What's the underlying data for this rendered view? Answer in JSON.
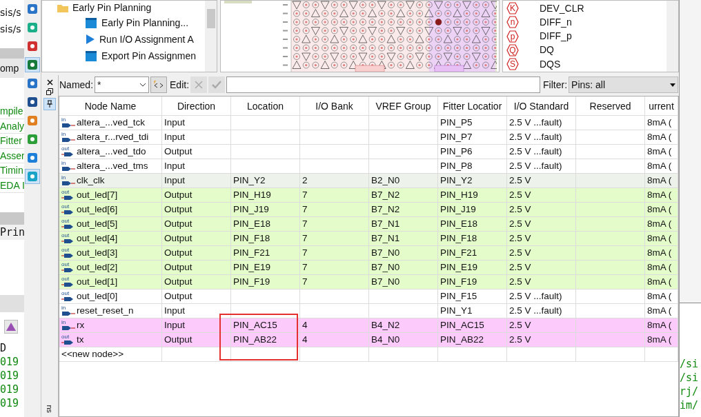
{
  "main_app": {
    "top_paths": [
      "sis/s",
      "sis/s"
    ],
    "panel_header": "omp",
    "flow_items": [
      "mpile",
      "Analy",
      "Fitter",
      "Asser",
      "Timin",
      "EDA I"
    ],
    "console_tab": "Prin",
    "message_header": "D",
    "message_lines": [
      "019",
      "019",
      "019",
      "019"
    ],
    "right_fragments": [
      "/si",
      "/si",
      "rj/",
      "im/"
    ]
  },
  "pin_planner": {
    "tasks": [
      {
        "label": "Early Pin Planning",
        "kind": "folder"
      },
      {
        "label": "Early Pin Planning...",
        "kind": "task"
      },
      {
        "label": "Run I/O Assignment A",
        "kind": "run"
      },
      {
        "label": "Export Pin Assignmen",
        "kind": "task"
      }
    ],
    "legend": [
      {
        "symbol": "K",
        "label": "DEV_CLR"
      },
      {
        "symbol": "n",
        "label": "DIFF_n"
      },
      {
        "symbol": "p",
        "label": "DIFF_p"
      },
      {
        "symbol": "Q",
        "label": "DQ"
      },
      {
        "symbol": "S",
        "label": "DQS"
      }
    ],
    "side_tab": "ns",
    "toolbar": {
      "named_label": "Named:",
      "named_value": "*",
      "edit_label": "Edit:",
      "filter_label": "Filter:",
      "filter_value": "Pins: all"
    },
    "table": {
      "columns": [
        "Node Name",
        "Direction",
        "Location",
        "I/O Bank",
        "VREF Group",
        "Fitter Locatior",
        "I/O Standard",
        "Reserved",
        "urrent"
      ],
      "rows": [
        {
          "kind": "in",
          "pin_label": "in",
          "name": "altera_...ved_tck",
          "direction": "Input",
          "fitter_location": "PIN_P5",
          "io_standard": "2.5 V ...fault)",
          "current": "8mA ("
        },
        {
          "kind": "in",
          "pin_label": "in",
          "name": "altera_r...rved_tdi",
          "direction": "Input",
          "fitter_location": "PIN_P7",
          "io_standard": "2.5 V ...fault)",
          "current": "8mA ("
        },
        {
          "kind": "out",
          "pin_label": "out",
          "name": "altera_...ved_tdo",
          "direction": "Output",
          "fitter_location": "PIN_P6",
          "io_standard": "2.5 V ...fault)",
          "current": "8mA ("
        },
        {
          "kind": "in",
          "pin_label": "in",
          "name": "altera_...ved_tms",
          "direction": "Input",
          "fitter_location": "PIN_P8",
          "io_standard": "2.5 V ...fault)",
          "current": "8mA ("
        },
        {
          "kind": "in",
          "pin_label": "in",
          "color": "#edf3ea",
          "name": "clk_clk",
          "direction": "Input",
          "location": "PIN_Y2",
          "io_bank": "2",
          "vref_group": "B2_N0",
          "fitter_location": "PIN_Y2",
          "io_standard": "2.5 V",
          "current": "8mA ("
        },
        {
          "kind": "out",
          "pin_label": "out",
          "color": "#e3fcc9",
          "name": "out_led[7]",
          "direction": "Output",
          "location": "PIN_H19",
          "io_bank": "7",
          "vref_group": "B7_N2",
          "fitter_location": "PIN_H19",
          "io_standard": "2.5 V",
          "current": "8mA ("
        },
        {
          "kind": "out",
          "pin_label": "out",
          "color": "#e3fcc9",
          "name": "out_led[6]",
          "direction": "Output",
          "location": "PIN_J19",
          "io_bank": "7",
          "vref_group": "B7_N2",
          "fitter_location": "PIN_J19",
          "io_standard": "2.5 V",
          "current": "8mA ("
        },
        {
          "kind": "out",
          "pin_label": "out",
          "color": "#e3fcc9",
          "name": "out_led[5]",
          "direction": "Output",
          "location": "PIN_E18",
          "io_bank": "7",
          "vref_group": "B7_N1",
          "fitter_location": "PIN_E18",
          "io_standard": "2.5 V",
          "current": "8mA ("
        },
        {
          "kind": "out",
          "pin_label": "out",
          "color": "#e3fcc9",
          "name": "out_led[4]",
          "direction": "Output",
          "location": "PIN_F18",
          "io_bank": "7",
          "vref_group": "B7_N1",
          "fitter_location": "PIN_F18",
          "io_standard": "2.5 V",
          "current": "8mA ("
        },
        {
          "kind": "out",
          "pin_label": "out",
          "color": "#e3fcc9",
          "name": "out_led[3]",
          "direction": "Output",
          "location": "PIN_F21",
          "io_bank": "7",
          "vref_group": "B7_N0",
          "fitter_location": "PIN_F21",
          "io_standard": "2.5 V",
          "current": "8mA ("
        },
        {
          "kind": "out",
          "pin_label": "out",
          "color": "#e3fcc9",
          "name": "out_led[2]",
          "direction": "Output",
          "location": "PIN_E19",
          "io_bank": "7",
          "vref_group": "B7_N0",
          "fitter_location": "PIN_E19",
          "io_standard": "2.5 V",
          "current": "8mA ("
        },
        {
          "kind": "out",
          "pin_label": "out",
          "color": "#e3fcc9",
          "name": "out_led[1]",
          "direction": "Output",
          "location": "PIN_F19",
          "io_bank": "7",
          "vref_group": "B7_N0",
          "fitter_location": "PIN_F19",
          "io_standard": "2.5 V",
          "current": "8mA ("
        },
        {
          "kind": "out",
          "pin_label": "out",
          "name": "out_led[0]",
          "direction": "Output",
          "fitter_location": "PIN_F15",
          "io_standard": "2.5 V ...fault)",
          "current": "8mA ("
        },
        {
          "kind": "in",
          "pin_label": "in",
          "name": "reset_reset_n",
          "direction": "Input",
          "fitter_location": "PIN_Y1",
          "io_standard": "2.5 V ...fault)",
          "current": "8mA ("
        },
        {
          "kind": "in",
          "pin_label": "in",
          "color": "#fccbfc",
          "name": "rx",
          "direction": "Input",
          "location": "PIN_AC15",
          "io_bank": "4",
          "vref_group": "B4_N2",
          "fitter_location": "PIN_AC15",
          "io_standard": "2.5 V",
          "current": "8mA ("
        },
        {
          "kind": "out",
          "pin_label": "out",
          "color": "#fccbfc",
          "name": "tx",
          "direction": "Output",
          "location": "PIN_AB22",
          "io_bank": "4",
          "vref_group": "B4_N0",
          "fitter_location": "PIN_AB22",
          "io_standard": "2.5 V",
          "current": "8mA ("
        },
        {
          "kind": "new",
          "name": "<<new node>>"
        }
      ]
    }
  }
}
